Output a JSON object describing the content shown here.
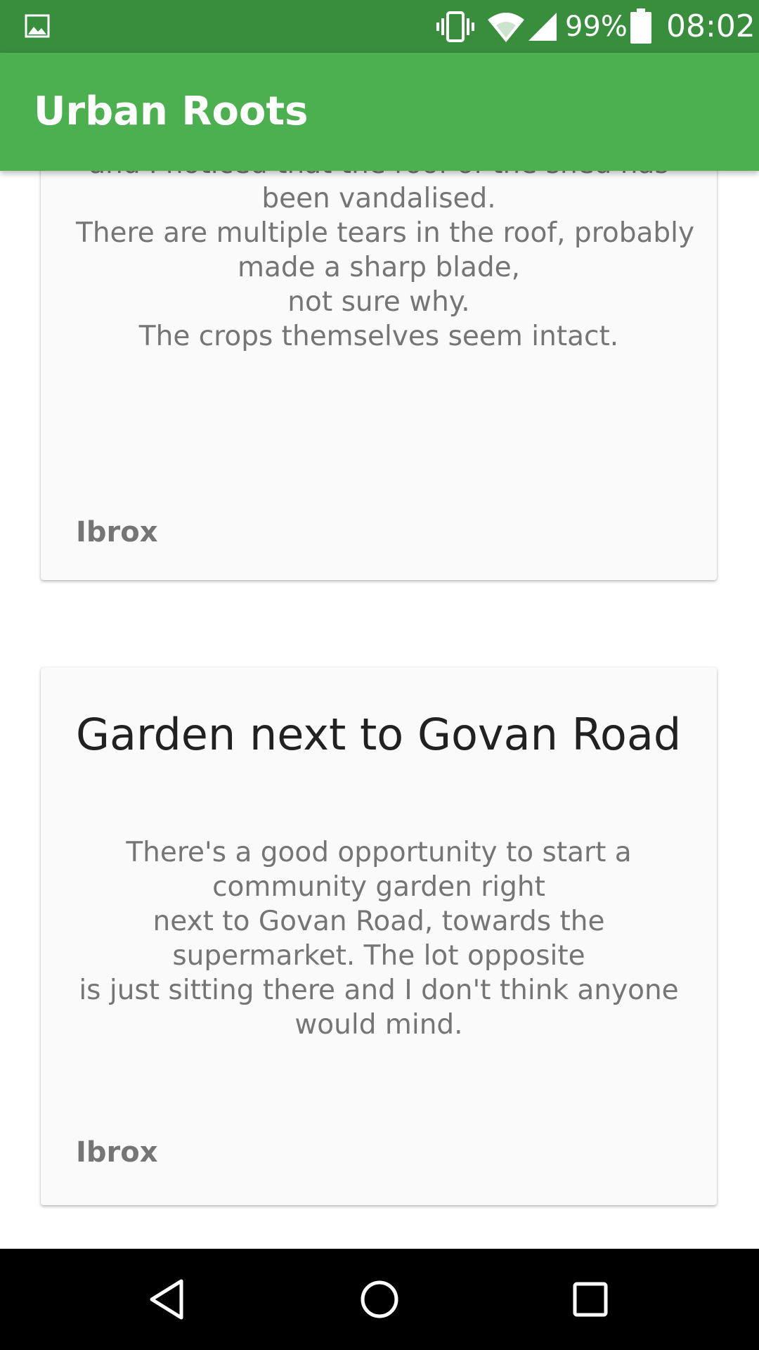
{
  "status_bar": {
    "battery_percent": "99%",
    "time": "08:02",
    "icons": [
      "gallery-icon",
      "vibrate-icon",
      "wifi-icon",
      "signal-icon",
      "battery-icon"
    ]
  },
  "app_bar": {
    "title": "Urban Roots"
  },
  "cards": [
    {
      "body_lines": [
        "and I noticed that the roof of the shed has",
        "been vandalised.",
        "There are multiple tears in the roof, probably",
        "made a sharp blade,",
        "not sure why.",
        "The crops themselves seem intact."
      ],
      "location": "Ibrox"
    },
    {
      "title": "Garden next to Govan Road",
      "body_lines": [
        "There's a good opportunity to start a",
        "community garden right",
        "next to Govan Road, towards the",
        "supermarket. The lot opposite",
        "is just sitting there and I don't think anyone",
        "would mind."
      ],
      "location": "Ibrox"
    }
  ],
  "nav_bar": {
    "buttons": [
      "back-icon",
      "home-icon",
      "recents-icon"
    ]
  },
  "colors": {
    "status_bar": "#388e3c",
    "app_bar": "#4caf50",
    "card_background": "#fafafa",
    "body_text": "#757575",
    "title_text": "#212121",
    "nav_bar": "#000000"
  }
}
